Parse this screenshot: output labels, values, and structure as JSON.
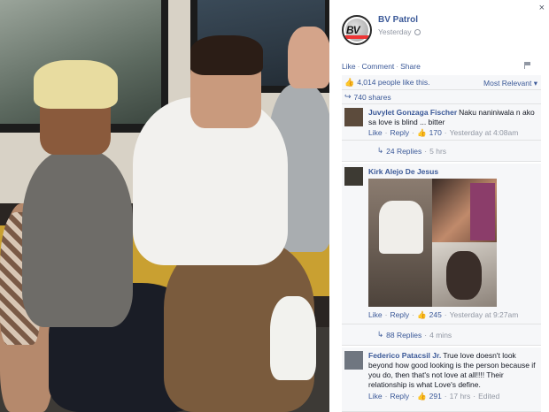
{
  "post": {
    "page_name": "BV Patrol",
    "logo_text": "BV",
    "timestamp": "Yesterday",
    "close_label": "×",
    "actions": {
      "like": "Like",
      "comment": "Comment",
      "share": "Share"
    },
    "likes_text": "4,014 people like this.",
    "sort_label": "Most Relevant",
    "shares_text": "740 shares"
  },
  "comments": [
    {
      "name": "Juvylet Gonzaga Fischer",
      "text": "Naku naniniwala n ako sa love is blind ... bitter",
      "like": "Like",
      "reply": "Reply",
      "likes": "170",
      "time": "Yesterday at 4:08am",
      "replies_label": "24 Replies",
      "replies_time": "5 hrs"
    },
    {
      "name": "Kirk Alejo De Jesus",
      "text": "",
      "like": "Like",
      "reply": "Reply",
      "likes": "245",
      "time": "Yesterday at 9:27am",
      "replies_label": "88 Replies",
      "replies_time": "4 mins"
    },
    {
      "name": "Federico Patacsil Jr.",
      "text": "True love doesn't look beyond how good looking is the person because if you do, then that's not love at all!!!! Their relationship is what Love's define.",
      "like": "Like",
      "reply": "Reply",
      "likes": "291",
      "time": "17 hrs",
      "edited": "Edited"
    }
  ],
  "colors": {
    "link": "#3b5998",
    "muted": "#9197a3",
    "panel_bg": "#f6f7f9"
  },
  "icons": [
    "close-icon",
    "globe-icon",
    "flag-icon",
    "thumbs-up-icon",
    "share-icon",
    "reply-arrow-icon"
  ]
}
